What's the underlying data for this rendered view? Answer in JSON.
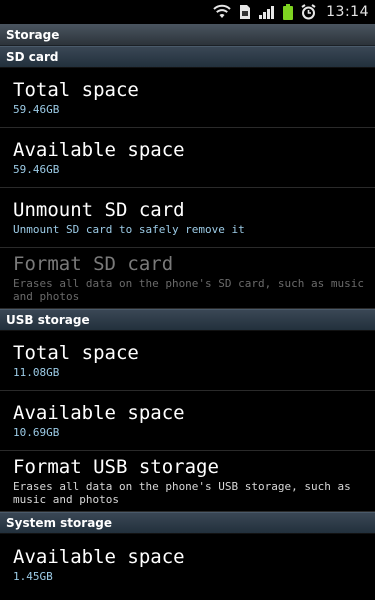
{
  "status_bar": {
    "time": "13:14",
    "icons": [
      "wifi-icon",
      "sd-card-icon",
      "signal-icon",
      "battery-icon",
      "alarm-icon"
    ],
    "battery_color": "#7ed321"
  },
  "title_bar": {
    "title": "Storage"
  },
  "sections": {
    "sd_card": {
      "header": "SD card",
      "total": {
        "title": "Total space",
        "summary": "59.46GB"
      },
      "available": {
        "title": "Available space",
        "summary": "59.46GB"
      },
      "unmount": {
        "title": "Unmount SD card",
        "summary": "Unmount SD card to safely remove it"
      },
      "format": {
        "title": "Format SD card",
        "summary": "Erases all data on the phone's SD card, such as music and photos"
      }
    },
    "usb_storage": {
      "header": "USB storage",
      "total": {
        "title": "Total space",
        "summary": "11.08GB"
      },
      "available": {
        "title": "Available space",
        "summary": "10.69GB"
      },
      "format": {
        "title": "Format USB storage",
        "summary": "Erases all data on the phone's USB storage, such as music and photos"
      }
    },
    "system_storage": {
      "header": "System storage",
      "available": {
        "title": "Available space",
        "summary": "1.45GB"
      }
    }
  },
  "colors": {
    "background": "#000000",
    "summary_text": "#9ccbe6",
    "disabled_text": "#7a7a7a",
    "section_header": "#2c3a48"
  }
}
